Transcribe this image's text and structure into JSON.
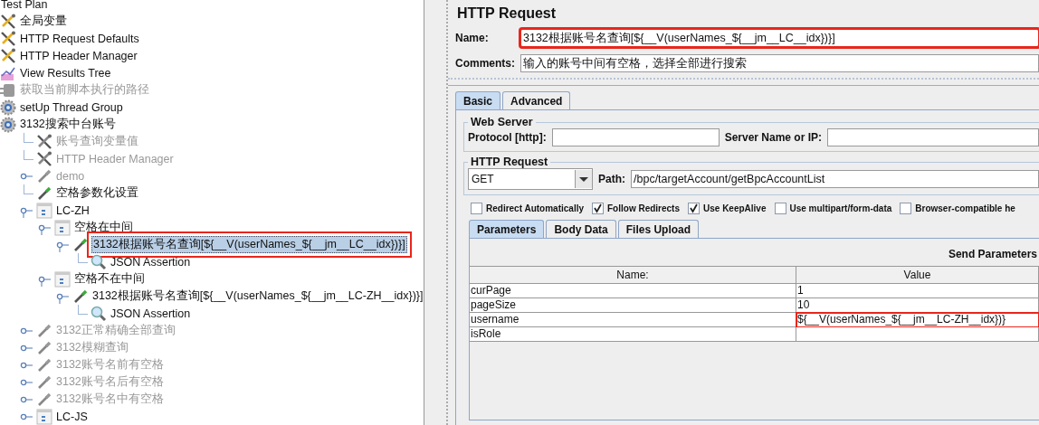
{
  "tree": {
    "label": "Test Plan",
    "children": [
      {
        "label": "全局变量",
        "kind": "config",
        "disabled": false,
        "selected": false
      },
      {
        "label": "HTTP Request Defaults",
        "kind": "config",
        "disabled": false,
        "selected": false
      },
      {
        "label": "HTTP Header Manager",
        "kind": "config",
        "disabled": false,
        "selected": false
      },
      {
        "label": "View Results Tree",
        "kind": "listener",
        "disabled": false,
        "selected": false
      },
      {
        "label": "获取当前脚本执行的路径",
        "kind": "preprocessor",
        "disabled": true,
        "selected": false
      },
      {
        "label": "setUp Thread Group",
        "kind": "thread",
        "disabled": false,
        "selected": false
      },
      {
        "label": "3132搜索中台账号",
        "kind": "thread",
        "disabled": false,
        "selected": false,
        "children": [
          {
            "label": "账号查询变量值",
            "kind": "config",
            "disabled": true,
            "selected": false
          },
          {
            "label": "HTTP Header Manager",
            "kind": "config",
            "disabled": true,
            "selected": false
          },
          {
            "label": "demo",
            "kind": "sampler",
            "disabled": true,
            "selected": false,
            "expanded": false
          },
          {
            "label": "空格参数化设置",
            "kind": "sampler",
            "disabled": false,
            "selected": false
          },
          {
            "label": "LC-ZH",
            "kind": "controller",
            "disabled": false,
            "selected": false,
            "expanded": true,
            "children": [
              {
                "label": "空格在中间",
                "kind": "controller",
                "disabled": false,
                "selected": false,
                "expanded": true,
                "children": [
                  {
                    "label": "3132根据账号名查询[${__V(userNames_${__jm__LC__idx})}]",
                    "kind": "sampler",
                    "disabled": false,
                    "selected": true,
                    "annotated": true,
                    "expanded": true,
                    "children": [
                      {
                        "label": "JSON Assertion",
                        "kind": "assertion",
                        "disabled": false,
                        "selected": false
                      }
                    ]
                  }
                ]
              },
              {
                "label": "空格不在中间",
                "kind": "controller",
                "disabled": false,
                "selected": false,
                "expanded": true,
                "children": [
                  {
                    "label": "3132根据账号名查询[${__V(userNames_${__jm__LC-ZH__idx})}]",
                    "kind": "sampler",
                    "disabled": false,
                    "selected": false,
                    "expanded": true,
                    "children": [
                      {
                        "label": "JSON Assertion",
                        "kind": "assertion",
                        "disabled": false,
                        "selected": false
                      }
                    ]
                  }
                ]
              }
            ]
          },
          {
            "label": "3132正常精确全部查询",
            "kind": "sampler",
            "disabled": true,
            "selected": false,
            "expanded": false
          },
          {
            "label": "3132模糊查询",
            "kind": "sampler",
            "disabled": true,
            "selected": false,
            "expanded": false
          },
          {
            "label": "3132账号名前有空格",
            "kind": "sampler",
            "disabled": true,
            "selected": false,
            "expanded": false
          },
          {
            "label": "3132账号名后有空格",
            "kind": "sampler",
            "disabled": true,
            "selected": false,
            "expanded": false
          },
          {
            "label": "3132账号名中有空格",
            "kind": "sampler",
            "disabled": true,
            "selected": false,
            "expanded": false
          },
          {
            "label": "LC-JS",
            "kind": "controller",
            "disabled": false,
            "selected": false,
            "expanded": false
          }
        ]
      }
    ]
  },
  "panel": {
    "title": "HTTP Request",
    "name": {
      "label": "Name:",
      "value": "3132根据账号名查询[${__V(userNames_${__jm__LC__idx})}]",
      "annotated": true
    },
    "comments": {
      "label": "Comments:",
      "value": "输入的账号中间有空格，选择全部进行搜索"
    },
    "tabs": [
      {
        "label": "Basic",
        "selected": true
      },
      {
        "label": "Advanced",
        "selected": false
      }
    ],
    "web_server": {
      "title": "Web Server",
      "protocol_label": "Protocol [http]:",
      "server_label": "Server Name or IP:"
    },
    "http_request": {
      "title": "HTTP Request",
      "method": "GET",
      "path_label": "Path:",
      "path": "/bpc/targetAccount/getBpcAccountList"
    },
    "options": [
      {
        "label": "Redirect Automatically",
        "checked": false
      },
      {
        "label": "Follow Redirects",
        "checked": true
      },
      {
        "label": "Use KeepAlive",
        "checked": true
      },
      {
        "label": "Use multipart/form-data",
        "checked": false
      },
      {
        "label": "Browser-compatible he",
        "checked": false
      }
    ],
    "sub_tabs": [
      {
        "label": "Parameters",
        "selected": true
      },
      {
        "label": "Body Data",
        "selected": false
      },
      {
        "label": "Files Upload",
        "selected": false
      }
    ],
    "params_title": "Send Parameters",
    "columns": [
      "Name:",
      "Value"
    ],
    "rows": [
      {
        "name": "curPage",
        "value": "1",
        "annotated": false
      },
      {
        "name": "pageSize",
        "value": "10",
        "annotated": false
      },
      {
        "name": "username",
        "value": "${__V(userNames_${__jm__LC-ZH__idx})}",
        "annotated": true
      },
      {
        "name": "isRole",
        "value": "",
        "annotated": false
      }
    ]
  }
}
